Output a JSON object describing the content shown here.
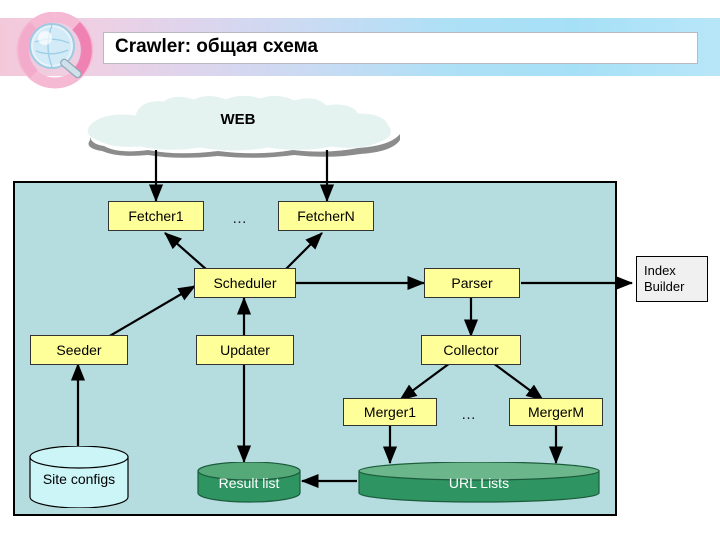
{
  "slide": {
    "title": "Crawler: общая схема",
    "logo_icon": "magnifier-globe-logo"
  },
  "diagram": {
    "cloud": {
      "label": "WEB"
    },
    "nodes": [
      {
        "id": "fetcher1",
        "label": "Fetcher1",
        "kind": "process"
      },
      {
        "id": "fetcherN",
        "label": "FetcherN",
        "kind": "process"
      },
      {
        "id": "scheduler",
        "label": "Scheduler",
        "kind": "process"
      },
      {
        "id": "parser",
        "label": "Parser",
        "kind": "process"
      },
      {
        "id": "seeder",
        "label": "Seeder",
        "kind": "process"
      },
      {
        "id": "updater",
        "label": "Updater",
        "kind": "process"
      },
      {
        "id": "collector",
        "label": "Collector",
        "kind": "process"
      },
      {
        "id": "merger1",
        "label": "Merger1",
        "kind": "process"
      },
      {
        "id": "mergerM",
        "label": "MergerM",
        "kind": "process"
      },
      {
        "id": "indexbuilder",
        "label_line1": "Index",
        "label_line2": "Builder",
        "kind": "external"
      }
    ],
    "ellipsis_fetchers": "…",
    "ellipsis_mergers": "…",
    "stores": [
      {
        "id": "siteconfigs",
        "label": "Site configs",
        "color": "#ccf5f7"
      },
      {
        "id": "resultlist",
        "label": "Result list",
        "color": "#2e9461"
      },
      {
        "id": "urllists",
        "label": "URL Lists",
        "color": "#2e9461"
      }
    ],
    "colors": {
      "container_bg": "#b5dcdf",
      "node_fill": "#ffff99",
      "external_fill": "#f0f0f0",
      "cloud_fill": "#e4f2f0",
      "cloud_shadow": "#8c8c8c",
      "db_green": "#2e9461",
      "db_cyan": "#ccf5f7",
      "connector": "#000000"
    }
  }
}
